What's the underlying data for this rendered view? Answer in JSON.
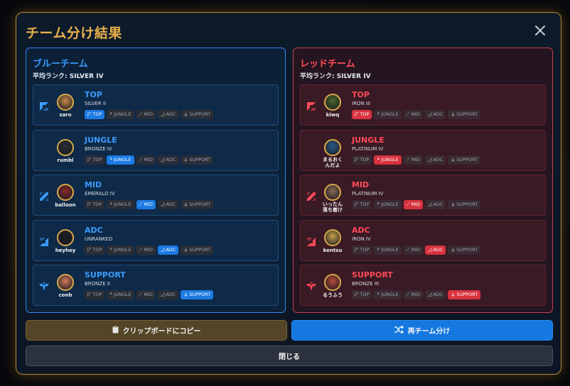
{
  "modal": {
    "title": "チーム分け結果",
    "close_icon": "close-icon"
  },
  "colors": {
    "accent_gold": "#e5b04a",
    "blue_team": "#3b9bff",
    "red_team": "#ff4a5a",
    "blue_active_chip": "#1d7ae4",
    "red_active_chip": "#d8333f"
  },
  "chip_labels": [
    "TOP",
    "JUNGLE",
    "MID",
    "ADC",
    "SUPPORT"
  ],
  "blue": {
    "title": "ブルーチーム",
    "avg_rank": "平均ランク: SILVER IV",
    "players": [
      {
        "name": "saro",
        "role": "TOP",
        "rank": "SILVER II",
        "active": 0,
        "avatar_color": "#c98a4a"
      },
      {
        "name": "rumbl",
        "role": "JUNGLE",
        "rank": "BRONZE IV",
        "active": 1,
        "avatar_color": "#2a2e36"
      },
      {
        "name": "balloon",
        "role": "MID",
        "rank": "EMERALD IV",
        "active": 2,
        "avatar_color": "#8a2a2a"
      },
      {
        "name": "heyhey",
        "role": "ADC",
        "rank": "UNRANKED",
        "active": 3,
        "avatar_color": "#1a1e24"
      },
      {
        "name": "conb",
        "role": "SUPPORT",
        "rank": "BRONZE II",
        "active": 4,
        "avatar_color": "#d47a5a"
      }
    ]
  },
  "red": {
    "title": "レッドチーム",
    "avg_rank": "平均ランク: SILVER IV",
    "players": [
      {
        "name": "kiwq",
        "role": "TOP",
        "rank": "IRON III",
        "active": 0,
        "avatar_color": "#4a6a2a"
      },
      {
        "name": "まるおくんだよ",
        "name_lines": [
          "まるおく",
          "んだよ"
        ],
        "role": "JUNGLE",
        "rank": "PLATINUM IV",
        "active": 1,
        "avatar_color": "#2a5a8a"
      },
      {
        "name": "いったん落ち着け",
        "name_lines": [
          "いったん",
          "落ち着け"
        ],
        "role": "MID",
        "rank": "PLATINUM IV",
        "active": 2,
        "avatar_color": "#8a6a5a"
      },
      {
        "name": "kentsu",
        "role": "ADC",
        "rank": "IRON IV",
        "active": 3,
        "avatar_color": "#c9a24a"
      },
      {
        "name": "るうふう",
        "role": "SUPPORT",
        "rank": "BRONZE III",
        "active": 4,
        "avatar_color": "#b84a3a"
      }
    ]
  },
  "buttons": {
    "copy": "クリップボードにコピー",
    "reshuffle": "再チーム分け",
    "close": "閉じる"
  }
}
